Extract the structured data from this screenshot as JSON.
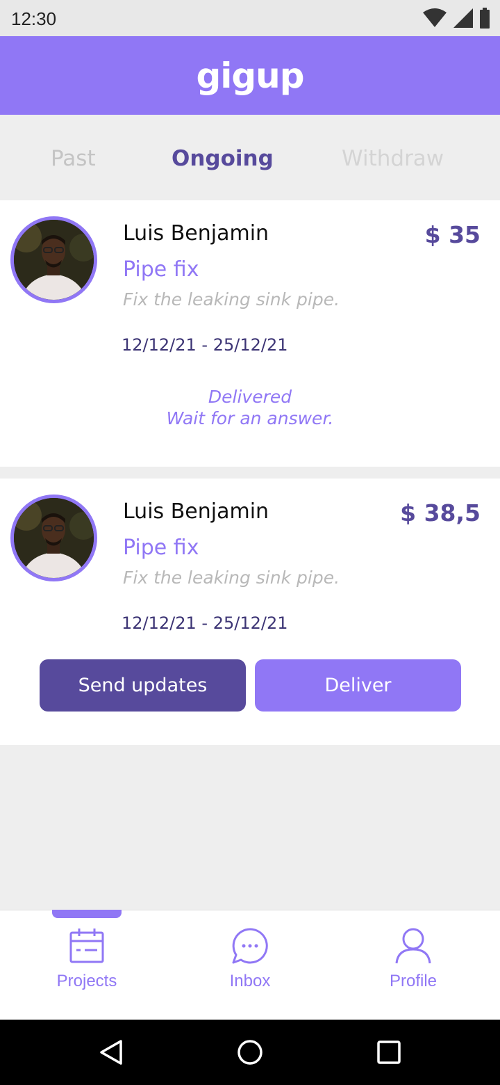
{
  "status_bar": {
    "time": "12:30"
  },
  "app": {
    "logo": "gigup",
    "brand_color": "#9077f5",
    "dark_accent": "#574a9c"
  },
  "tabs": [
    {
      "label": "Past",
      "active": false
    },
    {
      "label": "Ongoing",
      "active": true
    },
    {
      "label": "Withdraw",
      "active": false
    }
  ],
  "cards": [
    {
      "client_name": "Luis Benjamin",
      "price": "$ 35",
      "title": "Pipe fix",
      "description": "Fix the leaking sink pipe.",
      "dates": "12/12/21 - 25/12/21",
      "status_line_1": "Delivered",
      "status_line_2": "Wait for an answer."
    },
    {
      "client_name": "Luis Benjamin",
      "price": "$ 38,5",
      "title": "Pipe fix",
      "description": "Fix the leaking sink pipe.",
      "dates": "12/12/21 - 25/12/21",
      "send_updates_label": "Send updates",
      "deliver_label": "Deliver"
    }
  ],
  "bottom_nav": [
    {
      "label": "Projects",
      "icon": "calendar-icon",
      "active": true
    },
    {
      "label": "Inbox",
      "icon": "chat-bubble-icon",
      "active": false
    },
    {
      "label": "Profile",
      "icon": "person-icon",
      "active": false
    }
  ]
}
